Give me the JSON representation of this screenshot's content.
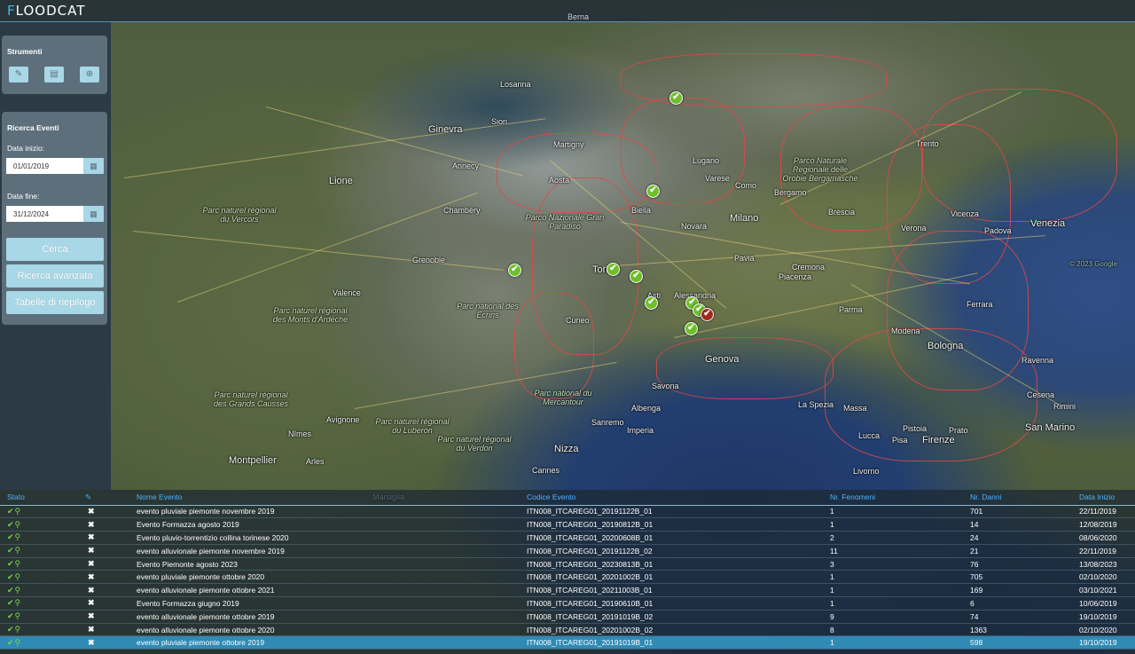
{
  "app": {
    "logo_text": "LOODCAT",
    "logo_mark": "F"
  },
  "header": {
    "map_top_label": "Berna"
  },
  "tools_panel": {
    "title": "Strumenti",
    "buttons": [
      {
        "icon": "edit-icon",
        "glyph": "✎"
      },
      {
        "icon": "document-icon",
        "glyph": "▤"
      },
      {
        "icon": "add-icon",
        "glyph": "⊕"
      }
    ]
  },
  "search_panel": {
    "title": "Ricerca Eventi",
    "start_label": "Data inizio:",
    "start_value": "01/01/2019",
    "end_label": "Data fine:",
    "end_value": "31/12/2024",
    "calendar_glyph": "▦",
    "search_button": "Cerca",
    "advanced_button": "Ricerca avanzata",
    "summary_button": "Tabelle di riepilogo"
  },
  "map": {
    "labels": [
      "Ginevra",
      "Lione",
      "Grenoble",
      "Torino",
      "Milano",
      "Genova",
      "Nizza",
      "Montpellier",
      "Bologna",
      "Venezia",
      "Firenze",
      "San Marino",
      "Brescia",
      "Bergamo",
      "Piacenza",
      "Parma",
      "Modena",
      "Alessandria",
      "Asti",
      "Cuneo",
      "Avignone",
      "Nîmes",
      "Valence",
      "Chambéry",
      "Annecy",
      "Biella",
      "Novara",
      "Pavia",
      "Cremona",
      "Verona",
      "Padova",
      "Vicenza",
      "Trento",
      "Ravenna",
      "Ferrara",
      "Pisa",
      "Livorno",
      "Lucca",
      "Pistoia",
      "Prato",
      "Cesena",
      "Rimini",
      "Sanremo",
      "Imperia",
      "Savona",
      "Albenga",
      "Cannes",
      "Arles",
      "Varese",
      "Como",
      "Lugano",
      "Sion",
      "Losanna",
      "Martigny",
      "Aosta",
      "La Spezia",
      "Massa",
      "Marsiglia"
    ],
    "areas": [
      "Parc naturel régional du Vercors",
      "Parc naturel régional des Monts d'Ardèche",
      "Parc national des Écrins",
      "Parc national du Mercantour",
      "Parc naturel régional du Verdon",
      "Parc naturel régional du Luberon",
      "Parc naturel régional des Grands Causses",
      "Parco Nazionale Gran Paradiso",
      "Parco Naturale Regionale delle Orobie Bergamasche"
    ],
    "attribution": "© 2023 Google"
  },
  "table": {
    "columns": [
      "Stato",
      "",
      "Nome Evento",
      "Codice Evento",
      "Nr. Fenomeni",
      "Nr. Danni",
      "Data Inizio"
    ],
    "edit_header_glyph": "✎",
    "status_glyph": "✔⚲",
    "delete_glyph": "✖",
    "rows": [
      {
        "name": "evento pluviale piemonte novembre 2019",
        "code": "ITN008_ITCAREG01_20191122B_01",
        "fenomeni": "1",
        "danni": "701",
        "date": "22/11/2019"
      },
      {
        "name": "Evento Formazza agosto 2019",
        "code": "ITN008_ITCAREG01_20190812B_01",
        "fenomeni": "1",
        "danni": "14",
        "date": "12/08/2019"
      },
      {
        "name": "Evento pluvio-torrentizio collina torinese 2020",
        "code": "ITN008_ITCAREG01_20200608B_01",
        "fenomeni": "2",
        "danni": "24",
        "date": "08/06/2020"
      },
      {
        "name": "evento alluvionale piemonte novembre 2019",
        "code": "ITN008_ITCAREG01_20191122B_02",
        "fenomeni": "11",
        "danni": "21",
        "date": "22/11/2019"
      },
      {
        "name": "Evento Piemonte agosto 2023",
        "code": "ITN008_ITCAREG01_20230813B_01",
        "fenomeni": "3",
        "danni": "76",
        "date": "13/08/2023"
      },
      {
        "name": "evento pluviale piemonte ottobre 2020",
        "code": "ITN008_ITCAREG01_20201002B_01",
        "fenomeni": "1",
        "danni": "705",
        "date": "02/10/2020"
      },
      {
        "name": "evento alluvionale piemonte ottobre 2021",
        "code": "ITN008_ITCAREG01_20211003B_01",
        "fenomeni": "1",
        "danni": "169",
        "date": "03/10/2021"
      },
      {
        "name": "Evento Formazza giugno 2019",
        "code": "ITN008_ITCAREG01_20190610B_01",
        "fenomeni": "1",
        "danni": "6",
        "date": "10/06/2019"
      },
      {
        "name": "evento alluvionale piemonte ottobre 2019",
        "code": "ITN008_ITCAREG01_20191019B_02",
        "fenomeni": "9",
        "danni": "74",
        "date": "19/10/2019"
      },
      {
        "name": "evento alluvionale piemonte ottobre 2020",
        "code": "ITN008_ITCAREG01_20201002B_02",
        "fenomeni": "8",
        "danni": "1363",
        "date": "02/10/2020"
      },
      {
        "name": "evento pluviale piemonte ottobre 2019",
        "code": "ITN008_ITCAREG01_20191019B_01",
        "fenomeni": "1",
        "danni": "598",
        "date": "19/10/2019",
        "selected": true
      }
    ]
  },
  "colors": {
    "accent": "#a8d7e6",
    "panel": "#5c6f7b",
    "header_link": "#4fb3ff",
    "selected_row": "#2f8ab4",
    "marker_ok": "#6fbf2a",
    "marker_alert": "#a12a1c",
    "border": "#e04848"
  }
}
